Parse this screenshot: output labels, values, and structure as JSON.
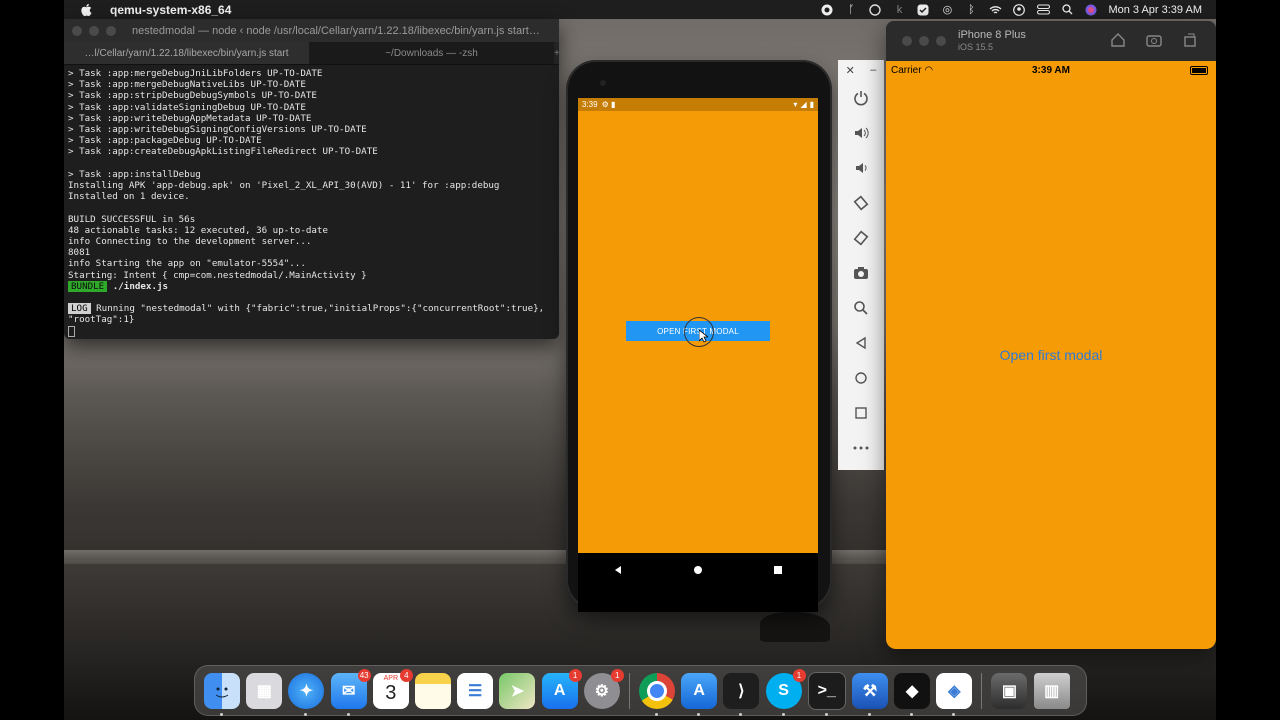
{
  "menubar": {
    "app_name": "qemu-system-x86_64",
    "datetime": "Mon 3 Apr  3:39 AM"
  },
  "terminal": {
    "title": "nestedmodal — node ‹ node /usr/local/Cellar/yarn/1.22.18/libexec/bin/yarn.js start…",
    "tab1": "…l/Cellar/yarn/1.22.18/libexec/bin/yarn.js start",
    "tab2": "~/Downloads — -zsh",
    "lines": [
      "> Task :app:mergeDebugJniLibFolders UP-TO-DATE",
      "> Task :app:mergeDebugNativeLibs UP-TO-DATE",
      "> Task :app:stripDebugDebugSymbols UP-TO-DATE",
      "> Task :app:validateSigningDebug UP-TO-DATE",
      "> Task :app:writeDebugAppMetadata UP-TO-DATE",
      "> Task :app:writeDebugSigningConfigVersions UP-TO-DATE",
      "> Task :app:packageDebug UP-TO-DATE",
      "> Task :app:createDebugApkListingFileRedirect UP-TO-DATE",
      "",
      "> Task :app:installDebug",
      "Installing APK 'app-debug.apk' on 'Pixel_2_XL_API_30(AVD) - 11' for :app:debug",
      "Installed on 1 device.",
      "",
      "BUILD SUCCESSFUL in 56s",
      "48 actionable tasks: 12 executed, 36 up-to-date",
      "info Connecting to the development server...",
      "8081",
      "info Starting the app on \"emulator-5554\"...",
      "Starting: Intent { cmp=com.nestedmodal/.MainActivity }"
    ],
    "bundle_badge": "BUNDLE",
    "bundle_text": " ./index.js",
    "log_badge": "LOG",
    "log_text": " Running \"nestedmodal\" with {\"fabric\":true,\"initialProps\":{\"concurrentRoot\":true},",
    "log_text2": "\"rootTag\":1}"
  },
  "android": {
    "status_time": "3:39",
    "button_label": "OPEN FIRST MODAL",
    "app_bg": "#f59b05",
    "button_color": "#2196f3"
  },
  "iphone": {
    "device_name": "iPhone 8 Plus",
    "os_version": "iOS 15.5",
    "carrier": "Carrier",
    "time": "3:39 AM",
    "button_label": "Open first modal"
  },
  "dock": {
    "items": [
      {
        "name": "Finder",
        "icon": "finder-icon"
      },
      {
        "name": "Launchpad",
        "icon": "launchpad-icon"
      },
      {
        "name": "Safari",
        "icon": "safari-icon"
      },
      {
        "name": "Mail",
        "icon": "mail-icon",
        "badge": "43"
      },
      {
        "name": "Calendar",
        "icon": "calendar-icon",
        "badge": "4",
        "month": "APR",
        "day": "3"
      },
      {
        "name": "Notes",
        "icon": "notes-icon"
      },
      {
        "name": "Reminders",
        "icon": "reminders-icon"
      },
      {
        "name": "Maps",
        "icon": "maps-icon"
      },
      {
        "name": "App Store",
        "icon": "app-store-icon",
        "badge": "1"
      },
      {
        "name": "System Preferences",
        "icon": "system-preferences-icon",
        "badge": "1"
      },
      {
        "name": "Chrome",
        "icon": "chrome-icon"
      },
      {
        "name": "Xcode Instruments",
        "icon": "xcode-icon"
      },
      {
        "name": "VS Code",
        "icon": "vscode-icon"
      },
      {
        "name": "Skype",
        "icon": "skype-icon",
        "badge": "1"
      },
      {
        "name": "Terminal",
        "icon": "terminal-icon"
      },
      {
        "name": "Xcode",
        "icon": "xcode-hammer-icon"
      },
      {
        "name": "Figma",
        "icon": "figma-icon"
      },
      {
        "name": "Android Studio",
        "icon": "android-studio-icon"
      },
      {
        "name": "Preview",
        "icon": "preview-icon"
      },
      {
        "name": "Trash",
        "icon": "trash-icon"
      }
    ]
  }
}
